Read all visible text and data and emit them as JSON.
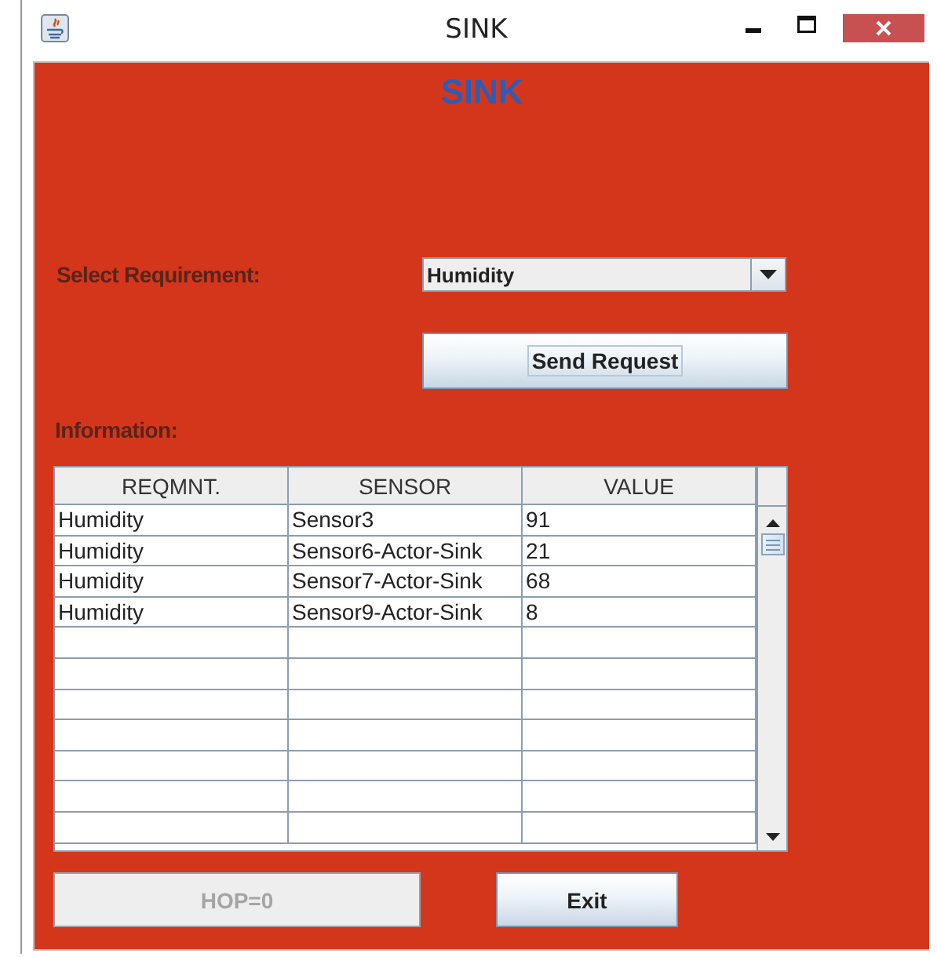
{
  "window": {
    "title": "SINK"
  },
  "heading": "SINK",
  "requirement": {
    "label": "Select Requirement:",
    "value": "Humidity"
  },
  "send_button": {
    "label": "Send Request",
    "disabled": false
  },
  "info_label": "Information:",
  "table": {
    "columns": [
      "REQMNT.",
      "SENSOR",
      "VALUE"
    ],
    "rows": [
      [
        "Humidity",
        "Sensor3",
        "91"
      ],
      [
        "Humidity",
        "Sensor6-Actor-Sink",
        "21"
      ],
      [
        "Humidity",
        "Sensor7-Actor-Sink",
        "68"
      ],
      [
        "Humidity",
        "Sensor9-Actor-Sink",
        "8"
      ]
    ]
  },
  "buttons": [
    {
      "label": "HOP=0",
      "disabled": true
    },
    {
      "label": "Exit",
      "disabled": false
    }
  ]
}
